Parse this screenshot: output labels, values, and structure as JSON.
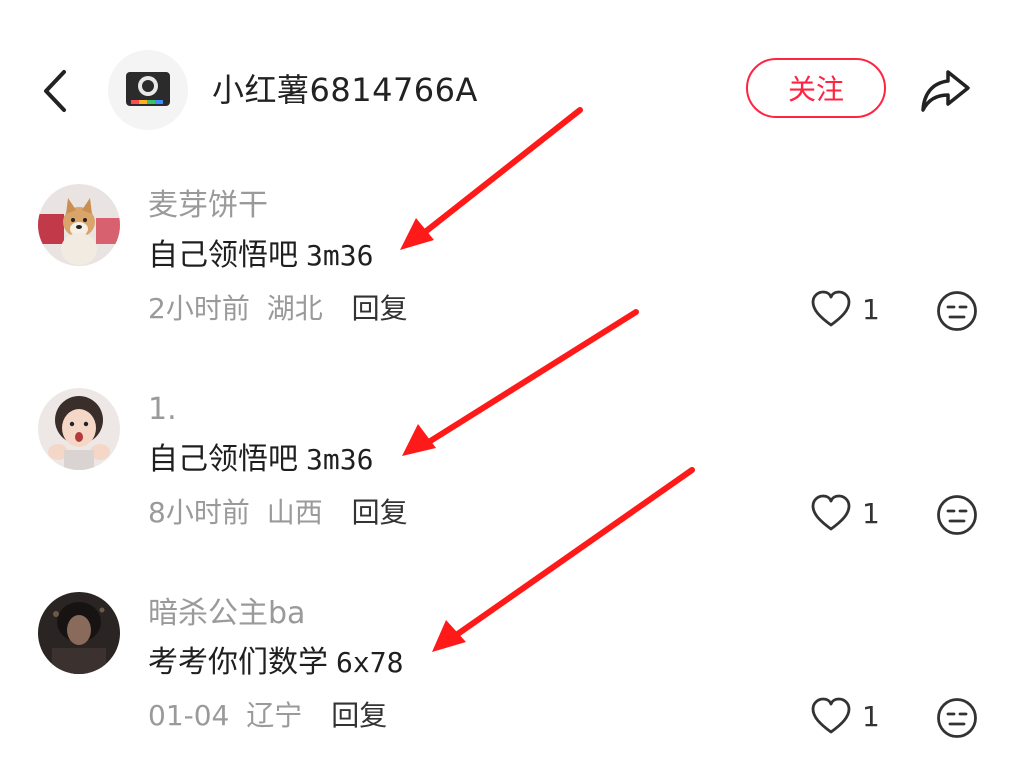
{
  "header": {
    "title": "小红薯6814766A",
    "follow_label": "关注"
  },
  "comments": [
    {
      "username": "麦芽饼干",
      "text": "自己领悟吧",
      "code": "3m36",
      "time": "2小时前",
      "location": "湖北",
      "reply_label": "回复",
      "likes": "1"
    },
    {
      "username": "1.",
      "text": "自己领悟吧",
      "code": "3m36",
      "time": "8小时前",
      "location": "山西",
      "reply_label": "回复",
      "likes": "1"
    },
    {
      "username": "暗杀公主ba",
      "text": "考考你们数学",
      "code": "6x78",
      "time": "01-04",
      "location": "辽宁",
      "reply_label": "回复",
      "likes": "1"
    }
  ],
  "colors": {
    "accent": "#ff2442",
    "arrow": "#ff1a1a",
    "muted_text": "#9a9a9a"
  }
}
